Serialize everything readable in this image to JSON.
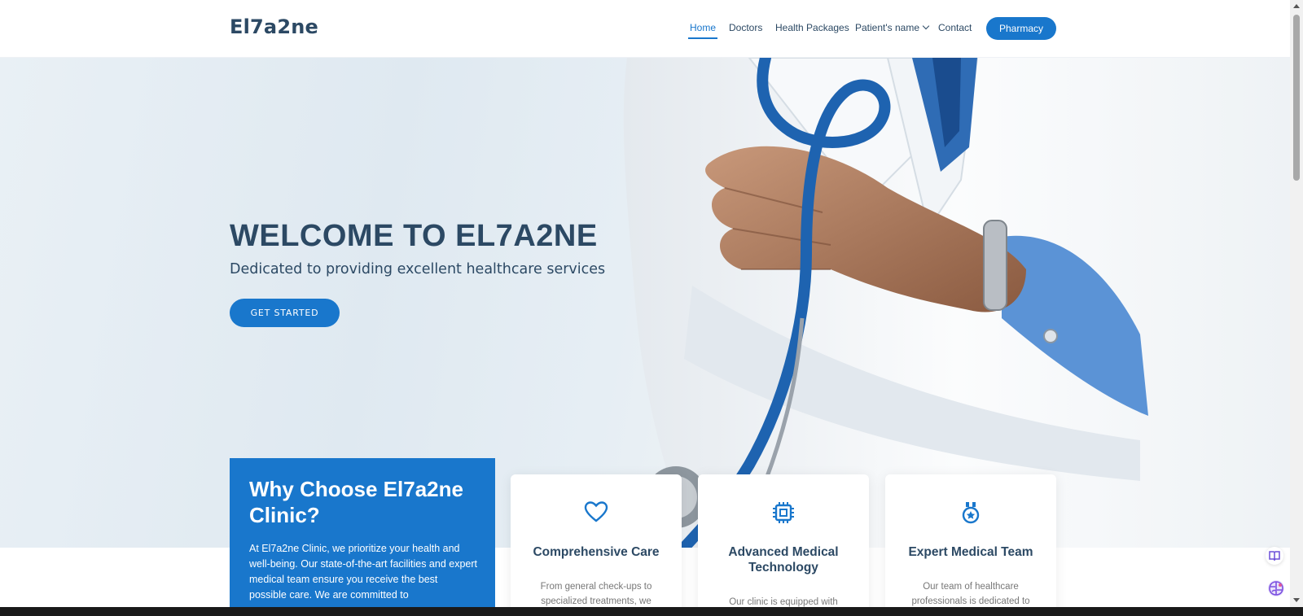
{
  "header": {
    "logo": "El7a2ne",
    "nav": {
      "home": "Home",
      "doctors": "Doctors",
      "health_packages": "Health Packages",
      "patient_name": "Patient's name",
      "contact": "Contact"
    },
    "pharmacy_button": "Pharmacy"
  },
  "hero": {
    "title": "WELCOME TO EL7A2NE",
    "subtitle": "Dedicated to providing excellent healthcare services",
    "cta": "GET STARTED"
  },
  "why": {
    "title": "Why Choose El7a2ne Clinic?",
    "text": "At El7a2ne Clinic, we prioritize your health and well-being. Our state-of-the-art facilities and expert medical team ensure you receive the best possible care. We are committed to"
  },
  "cards": [
    {
      "icon": "heart-icon",
      "title": "Comprehensive Care",
      "text": "From general check-ups to specialized treatments, we"
    },
    {
      "icon": "chip-icon",
      "title": "Advanced Medical Technology",
      "text": "Our clinic is equipped with the"
    },
    {
      "icon": "award-icon",
      "title": "Expert Medical Team",
      "text": "Our team of healthcare professionals is dedicated to"
    }
  ],
  "colors": {
    "accent": "#1977cc",
    "heading": "#2c4964",
    "body_text": "#777777"
  }
}
